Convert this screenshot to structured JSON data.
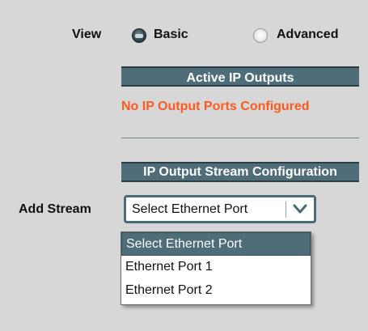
{
  "view": {
    "label": "View",
    "options": [
      {
        "label": "Basic",
        "selected": true
      },
      {
        "label": "Advanced",
        "selected": false
      }
    ]
  },
  "active_outputs": {
    "header": "Active IP Outputs",
    "message": "No IP Output Ports Configured"
  },
  "stream_config": {
    "header": "IP Output Stream Configuration"
  },
  "add_stream": {
    "label": "Add Stream",
    "selected_value": "Select Ethernet Port",
    "options": [
      "Select Ethernet Port",
      "Ethernet Port 1",
      "Ethernet Port 2"
    ],
    "highlighted_index": 0
  },
  "colors": {
    "header_bg": "#4f6d79",
    "error_text": "#ff5a1f",
    "panel_bg": "#d7d7d7"
  }
}
